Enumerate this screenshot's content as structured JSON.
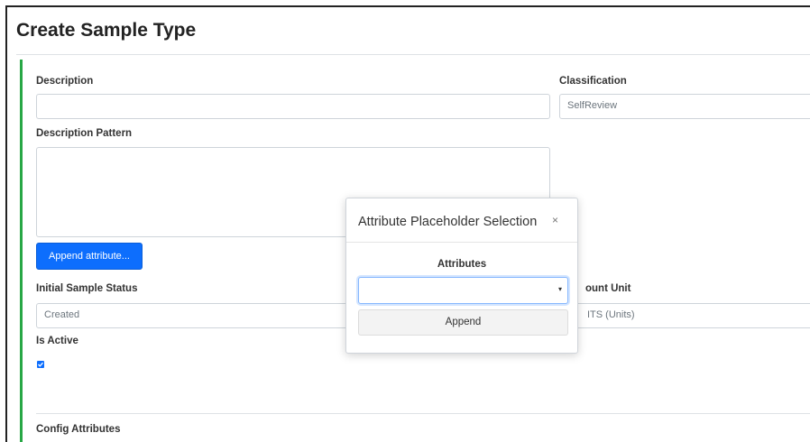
{
  "page": {
    "title": "Create Sample Type"
  },
  "form": {
    "description": {
      "label": "Description",
      "value": ""
    },
    "classification": {
      "label": "Classification",
      "value": "SelfReview"
    },
    "description_pattern": {
      "label": "Description Pattern",
      "value": ""
    },
    "append_button": "Append attribute...",
    "initial_status": {
      "label": "Initial Sample Status",
      "value": "Created"
    },
    "amount_unit": {
      "label_visible": "ount Unit",
      "value_visible": "ITS (Units)"
    },
    "is_active": {
      "label": "Is Active",
      "checked": true
    },
    "config_attributes": {
      "label": "Config Attributes"
    }
  },
  "modal": {
    "title": "Attribute Placeholder Selection",
    "close_glyph": "×",
    "attributes_label": "Attributes",
    "select_value": "",
    "caret": "▾",
    "append_button": "Append"
  },
  "colors": {
    "accent_green": "#28a745",
    "primary_blue": "#0d6efd"
  }
}
